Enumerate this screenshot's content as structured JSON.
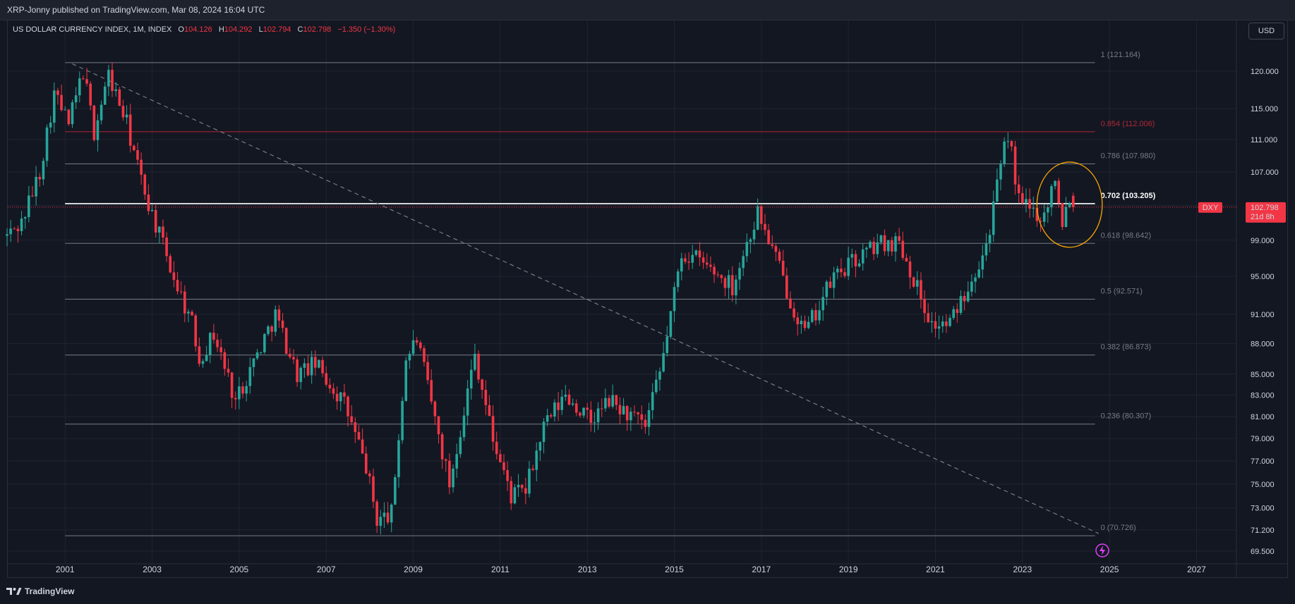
{
  "header": {
    "published": "XRP-Jonny published on TradingView.com, Mar 08, 2024 16:04 UTC"
  },
  "legend": {
    "title": "US DOLLAR CURRENCY INDEX, 1M, INDEX",
    "o_label": "O",
    "o_value": "104.126",
    "h_label": "H",
    "h_value": "104.292",
    "l_label": "L",
    "l_value": "102.794",
    "c_label": "C",
    "c_value": "102.798",
    "change": "−1.350 (−1.30%)"
  },
  "currency_button": "USD",
  "price_tag": {
    "symbol": "DXY",
    "price": "102.798",
    "countdown": "21d 8h",
    "color": "#f23645"
  },
  "brand": "TradingView",
  "colors": {
    "up": "#26a69a",
    "down": "#f23645",
    "background": "#131722",
    "circle": "#f7a600",
    "fib_highlight": "#b22833"
  },
  "chart_data": {
    "type": "candlestick",
    "timeframe": "1M",
    "y_scale": "log",
    "ylim": [
      68.5,
      125.5
    ],
    "xlim": [
      "1999-09",
      "2027-12"
    ],
    "x_ticks": [
      "2001",
      "2003",
      "2005",
      "2007",
      "2009",
      "2011",
      "2013",
      "2015",
      "2017",
      "2019",
      "2021",
      "2023",
      "2025",
      "2027"
    ],
    "y_ticks": [
      "120.000",
      "115.000",
      "111.000",
      "107.000",
      "103.000",
      "99.000",
      "95.000",
      "91.000",
      "88.000",
      "85.000",
      "83.000",
      "81.000",
      "79.000",
      "77.000",
      "75.000",
      "73.000",
      "71.200",
      "69.500"
    ],
    "fibonacci": {
      "start": "2001-01",
      "end": "2024-09",
      "levels": [
        {
          "label": "1 (121.164)",
          "value": 121.164,
          "style": "normal"
        },
        {
          "label": "0.854 (112.006)",
          "value": 112.006,
          "style": "red"
        },
        {
          "label": "0.786 (107.980)",
          "value": 107.98,
          "style": "normal"
        },
        {
          "label": "0.702 (103.205)",
          "value": 103.205,
          "style": "bold"
        },
        {
          "label": "0.618 (98.642)",
          "value": 98.642,
          "style": "normal"
        },
        {
          "label": "0.5 (92.571)",
          "value": 92.571,
          "style": "normal"
        },
        {
          "label": "0.382 (86.873)",
          "value": 86.873,
          "style": "normal"
        },
        {
          "label": "0.236 (80.307)",
          "value": 80.307,
          "style": "normal"
        },
        {
          "label": "0 (70.726)",
          "value": 70.726,
          "style": "normal"
        }
      ]
    },
    "trendline": {
      "from": {
        "date": "2001-03",
        "value": 121.0
      },
      "to": {
        "date": "2024-10",
        "value": 70.9
      }
    },
    "circle": {
      "center": {
        "date": "2024-02",
        "value": 103.0
      },
      "rx_months": 9,
      "ry_value_range": [
        98.2,
        108.2
      ]
    },
    "last_price": 102.798,
    "anchors": [
      [
        "1999-09",
        99.5
      ],
      [
        "2000-01",
        101
      ],
      [
        "2000-06",
        107
      ],
      [
        "2000-10",
        117
      ],
      [
        "2001-02",
        113
      ],
      [
        "2001-06",
        120
      ],
      [
        "2001-09",
        112
      ],
      [
        "2002-01",
        119.5
      ],
      [
        "2002-06",
        113
      ],
      [
        "2002-10",
        106
      ],
      [
        "2003-01",
        102
      ],
      [
        "2003-06",
        96
      ],
      [
        "2003-12",
        90
      ],
      [
        "2004-02",
        86.5
      ],
      [
        "2004-06",
        89
      ],
      [
        "2004-12",
        82.5
      ],
      [
        "2005-06",
        87
      ],
      [
        "2005-11",
        91
      ],
      [
        "2006-05",
        85
      ],
      [
        "2006-10",
        86
      ],
      [
        "2007-06",
        82.2
      ],
      [
        "2007-12",
        76.5
      ],
      [
        "2008-03",
        72
      ],
      [
        "2008-07",
        72.5
      ],
      [
        "2008-11",
        86.5
      ],
      [
        "2009-02",
        88.5
      ],
      [
        "2009-11",
        75
      ],
      [
        "2010-06",
        87
      ],
      [
        "2010-11",
        79
      ],
      [
        "2011-04",
        74
      ],
      [
        "2011-08",
        74.5
      ],
      [
        "2012-01",
        80
      ],
      [
        "2012-07",
        83
      ],
      [
        "2013-02",
        80.5
      ],
      [
        "2013-07",
        82.5
      ],
      [
        "2014-05",
        80
      ],
      [
        "2014-09",
        85
      ],
      [
        "2015-03",
        97.5
      ],
      [
        "2015-07",
        97
      ],
      [
        "2016-05",
        94
      ],
      [
        "2016-12",
        102.2
      ],
      [
        "2017-05",
        97
      ],
      [
        "2017-09",
        92.5
      ],
      [
        "2018-01",
        89
      ],
      [
        "2018-09",
        95
      ],
      [
        "2019-09",
        98.6
      ],
      [
        "2020-03",
        98.9
      ],
      [
        "2020-12",
        89.9
      ],
      [
        "2021-05",
        90
      ],
      [
        "2021-10",
        94.2
      ],
      [
        "2022-03",
        98.5
      ],
      [
        "2022-09",
        112
      ],
      [
        "2022-12",
        103.5
      ],
      [
        "2023-03",
        102.5
      ],
      [
        "2023-07",
        101.8
      ],
      [
        "2023-10",
        106.6
      ],
      [
        "2023-12",
        101.3
      ],
      [
        "2024-02",
        104.1
      ],
      [
        "2024-03",
        102.8
      ]
    ]
  }
}
